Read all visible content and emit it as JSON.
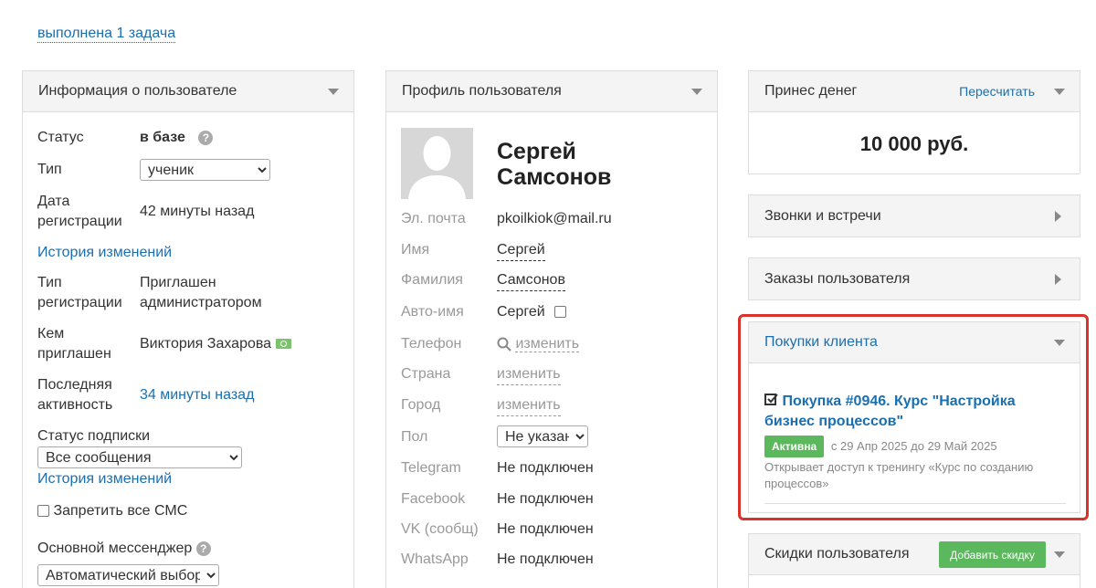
{
  "top_link": "выполнена 1 задача",
  "user_info": {
    "title": "Информация о пользователе",
    "status_label": "Статус",
    "status_value": "в базе",
    "type_label": "Тип",
    "type_value": "ученик",
    "reg_date_label_1": "Дата",
    "reg_date_label_2": "регистрации",
    "reg_date_value": "42 минуты назад",
    "history_link_1": "История изменений",
    "reg_type_label_1": "Тип",
    "reg_type_label_2": "регистрации",
    "reg_type_value_1": "Приглашен",
    "reg_type_value_2": "администратором",
    "invited_by_label_1": "Кем",
    "invited_by_label_2": "приглашен",
    "invited_by_value": "Виктория Захарова",
    "last_active_label_1": "Последняя",
    "last_active_label_2": "активность",
    "last_active_value": "34 минуты назад",
    "subscription_label": "Статус подписки",
    "subscription_value": "Все сообщения",
    "history_link_2": "История изменений",
    "block_sms_label": "Запретить все СМС",
    "messenger_label": "Основной мессенджер",
    "messenger_value": "Автоматический выбор"
  },
  "profile": {
    "title": "Профиль пользователя",
    "name_line_1": "Сергей",
    "name_line_2": "Самсонов",
    "fields": {
      "email_label": "Эл. почта",
      "email_value": "pkoilkiok@mail.ru",
      "first_name_label": "Имя",
      "first_name_value": "Сергей",
      "last_name_label": "Фамилия",
      "last_name_value": "Самсонов",
      "auto_name_label": "Авто-имя",
      "auto_name_value": "Сергей",
      "phone_label": "Телефон",
      "phone_value": "изменить",
      "country_label": "Страна",
      "country_value": "изменить",
      "city_label": "Город",
      "city_value": "изменить",
      "gender_label": "Пол",
      "gender_value": "Не указан",
      "telegram_label": "Telegram",
      "telegram_value": "Не подключен",
      "facebook_label": "Facebook",
      "facebook_value": "Не подключен",
      "vk_label": "VK (сообщ)",
      "vk_value": "Не подключен",
      "whatsapp_label": "WhatsApp",
      "whatsapp_value": "Не подключен"
    }
  },
  "money": {
    "title": "Принес денег",
    "recalc": "Пересчитать",
    "amount": "10 000 руб."
  },
  "calls": {
    "title": "Звонки и встречи"
  },
  "orders": {
    "title": "Заказы пользователя"
  },
  "purchases": {
    "title": "Покупки клиента",
    "item_title_1": "Покупка #0946. Курс \"Настройка",
    "item_title_2": "бизнес процессов\"",
    "badge": "Активна",
    "dates": "с 29 Апр 2025 до 29 Май 2025",
    "desc_1": "Открывает доступ к тренингу «Курс по созданию",
    "desc_2": "процессов»"
  },
  "discounts": {
    "title": "Скидки пользователя",
    "add_button": "Добавить скидку"
  },
  "colors": {
    "link": "#1a6fb0",
    "green": "#5cb85c",
    "highlight": "#d9322a"
  }
}
